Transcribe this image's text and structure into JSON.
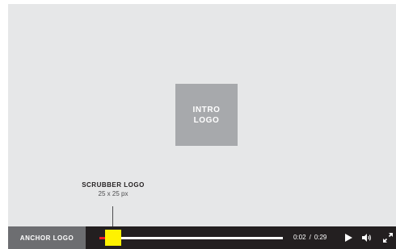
{
  "intro_logo": {
    "line1": "INTRO",
    "line2": "LOGO"
  },
  "scrubber_annotation": {
    "title": "SCRUBBER LOGO",
    "size": "25 x 25 px"
  },
  "controls": {
    "anchor_logo": "ANCHOR LOGO",
    "current_time": "0:02",
    "separator": "/",
    "duration": "0:29",
    "progress_fraction": 0.07,
    "icons": [
      "play-icon",
      "volume-icon",
      "fullscreen-icon"
    ]
  },
  "colors": {
    "stage": "#e6e7e8",
    "intro_logo": "#a7a9ac",
    "control_bar": "#231f20",
    "anchor_logo": "#6d6e71",
    "progress_played": "#ed1c24",
    "scrubber": "#fff200"
  }
}
